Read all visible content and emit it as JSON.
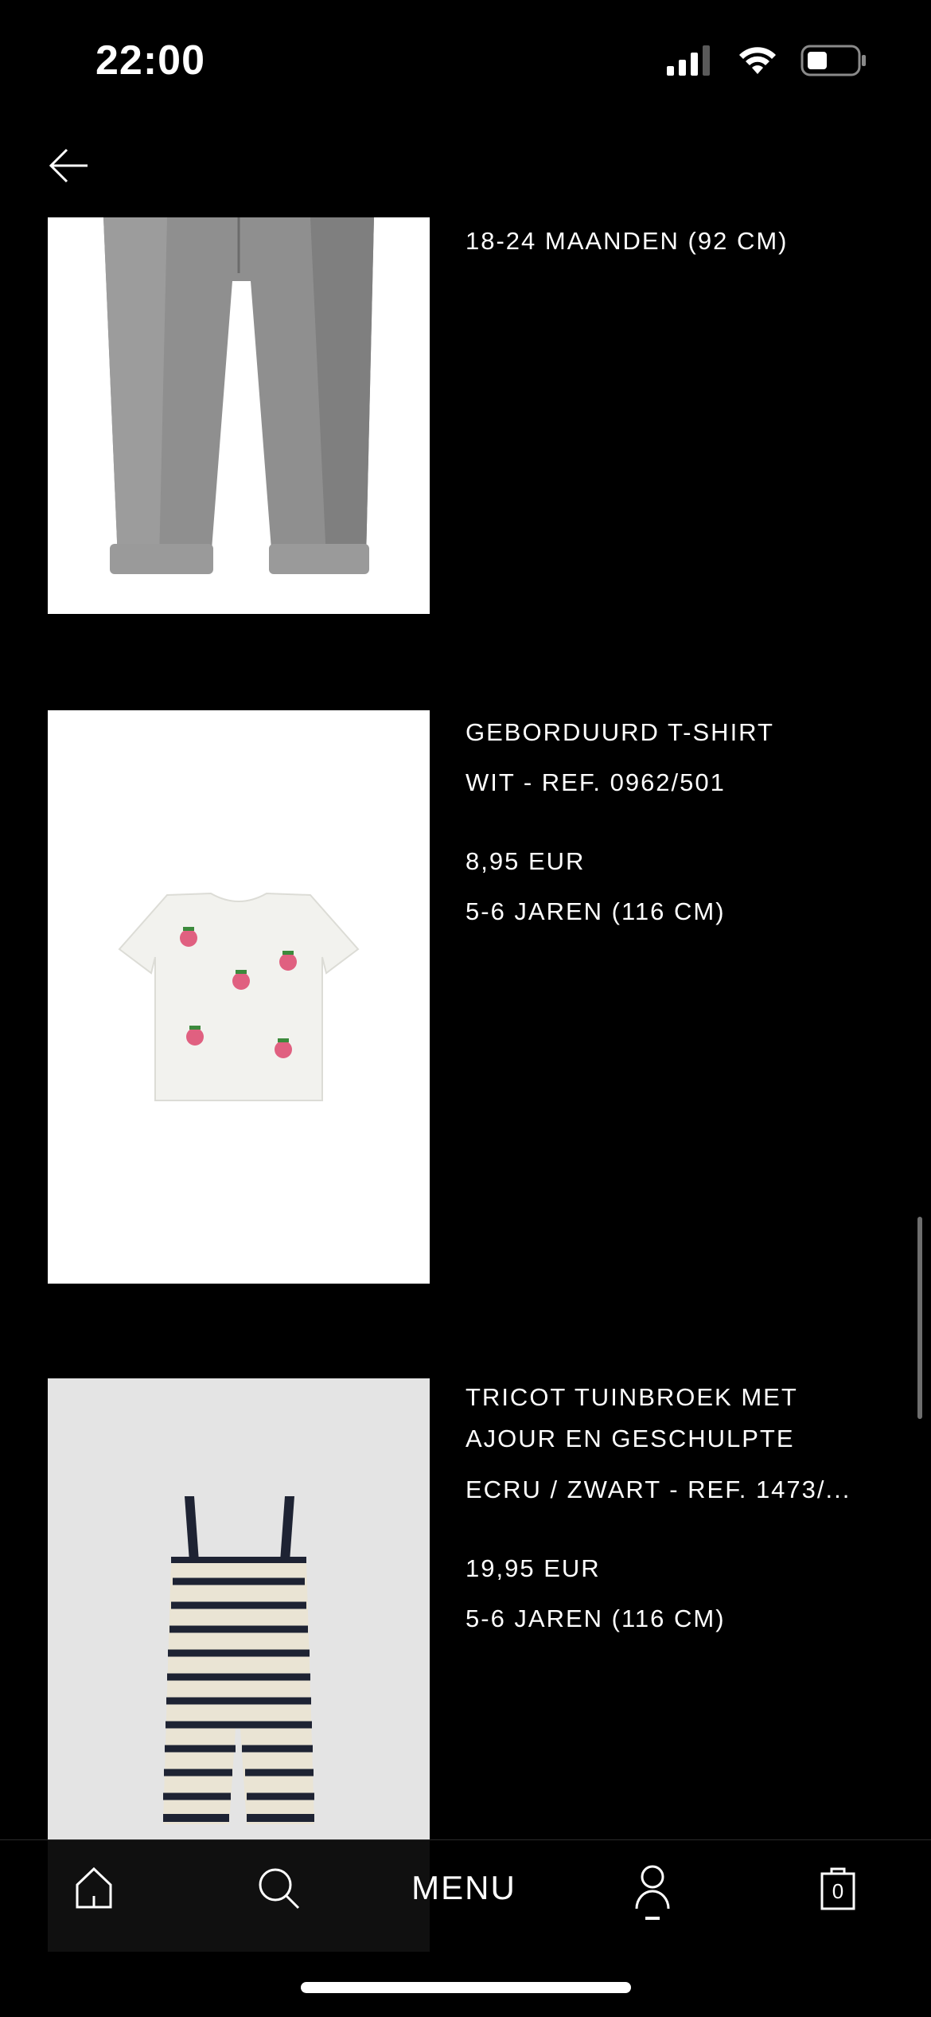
{
  "status_bar": {
    "time": "22:00"
  },
  "products": [
    {
      "size": "18-24 MAANDEN (92 CM)"
    },
    {
      "name": "GEBORDUURD T-SHIRT",
      "color_ref": "WIT - REF. 0962/501",
      "price": "8,95 EUR",
      "size": "5-6 JAREN (116 CM)"
    },
    {
      "name_line1": "TRICOT TUINBROEK MET",
      "name_line2": "AJOUR EN GESCHULPTE",
      "color_ref": "ECRU / ZWART - REF. 1473/...",
      "price": "19,95 EUR",
      "size": "5-6 JAREN (116 CM)"
    }
  ],
  "tabbar": {
    "menu_label": "MENU",
    "cart_count": "0"
  },
  "icons": {
    "back": "arrow-left-icon",
    "home": "home-icon",
    "search": "search-icon",
    "account": "user-icon",
    "cart": "bag-icon",
    "signal": "signal-icon",
    "wifi": "wifi-icon",
    "battery": "battery-icon"
  }
}
